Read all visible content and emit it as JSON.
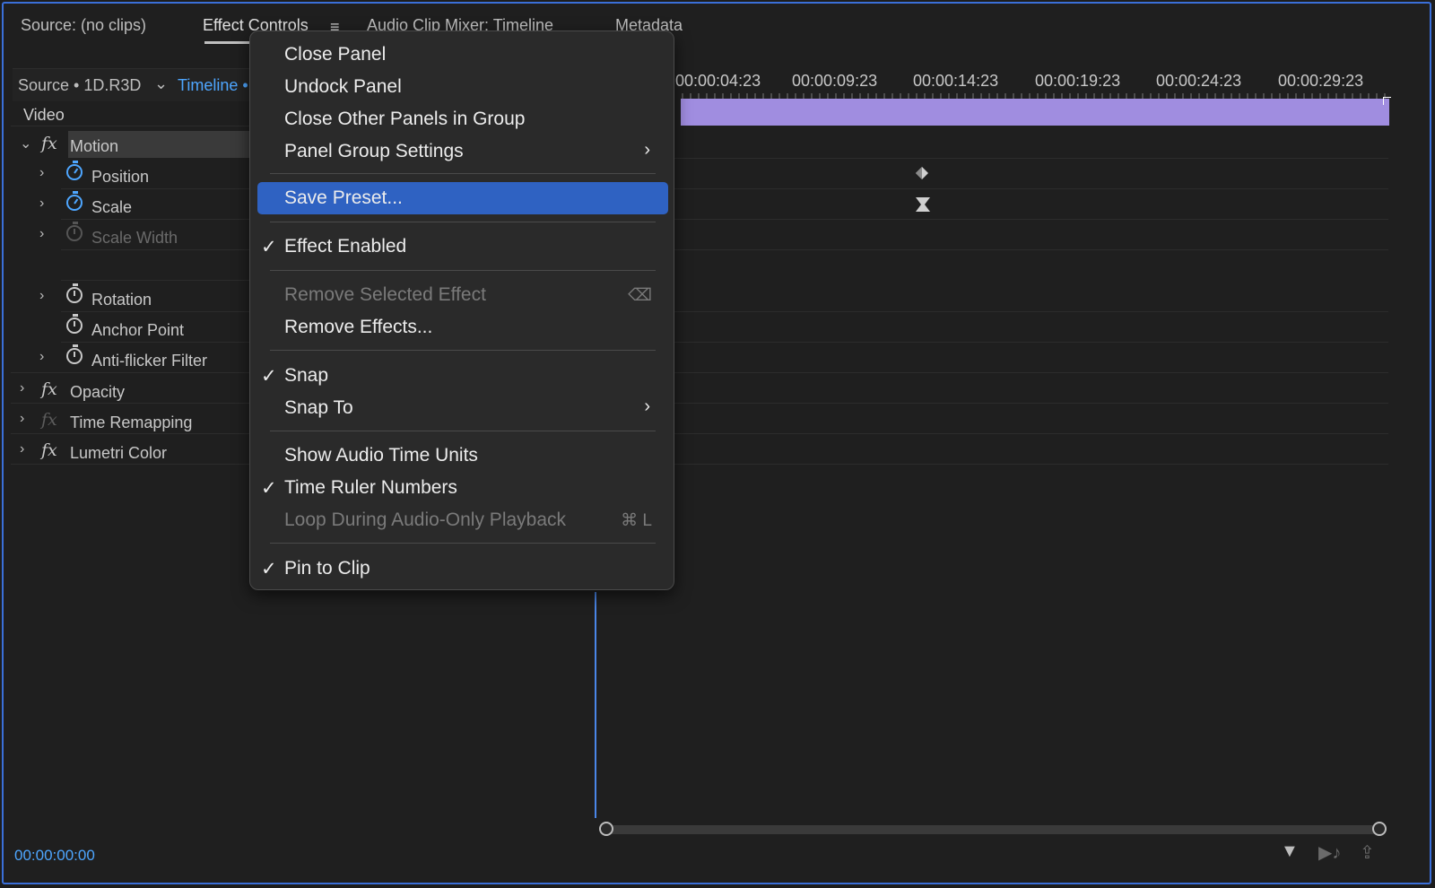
{
  "tabs": [
    {
      "label": "Source: (no clips)"
    },
    {
      "label": "Effect Controls"
    },
    {
      "label": "Audio Clip Mixer: Timeline"
    },
    {
      "label": "Metadata"
    }
  ],
  "panel_menu_icon": "hamburger-icon",
  "selector": {
    "source": "Source • 1D.R3D",
    "timeline": "Timeline •"
  },
  "section": {
    "video": "Video"
  },
  "effects": [
    {
      "label": "Motion"
    },
    {
      "label": "Position"
    },
    {
      "label": "Scale"
    },
    {
      "label": "Scale Width"
    },
    {
      "label": "Rotation"
    },
    {
      "label": "Anchor Point"
    },
    {
      "label": "Anti-flicker Filter"
    },
    {
      "label": "Opacity"
    },
    {
      "label": "Time Remapping"
    },
    {
      "label": "Lumetri Color"
    }
  ],
  "ruler": {
    "ticks": [
      "00:00:04:23",
      "00:00:09:23",
      "00:00:14:23",
      "00:00:19:23",
      "00:00:24:23",
      "00:00:29:23"
    ]
  },
  "timecode": "00:00:00:00",
  "colors": {
    "accent": "#4ea6ff",
    "clip": "#a08de0",
    "highlight": "#2f62c2"
  },
  "menu": {
    "close_panel": "Close Panel",
    "undock_panel": "Undock Panel",
    "close_other": "Close Other Panels in Group",
    "group_settings": "Panel Group Settings",
    "save_preset": "Save Preset...",
    "effect_enabled": "Effect Enabled",
    "remove_selected": "Remove Selected Effect",
    "remove_effects": "Remove Effects...",
    "snap": "Snap",
    "snap_to": "Snap To",
    "audio_units": "Show Audio Time Units",
    "ruler_numbers": "Time Ruler Numbers",
    "loop_audio": "Loop During Audio-Only Playback",
    "loop_shortcut": "⌘ L",
    "pin_clip": "Pin to Clip",
    "checkmark": "✓",
    "submenu_arrow": "›",
    "delete_shortcut": "⌫"
  }
}
